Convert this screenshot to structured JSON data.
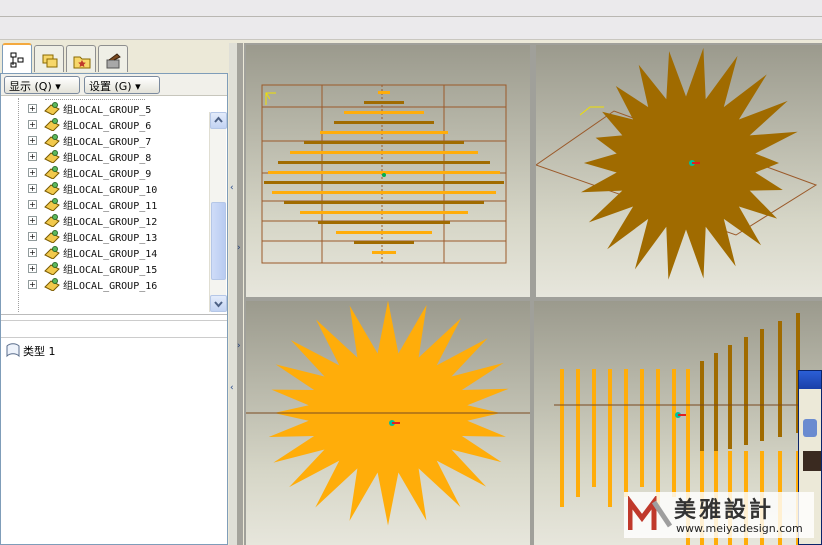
{
  "tabs": [
    {
      "icon": "model-tree-icon",
      "active": true
    },
    {
      "icon": "layers-icon",
      "active": false
    },
    {
      "icon": "favorites-folder-icon",
      "active": false
    },
    {
      "icon": "tools-icon",
      "active": false
    }
  ],
  "toolbar": {
    "show_label": "显示 (Q) ▾",
    "settings_label": "设置 (G) ▾"
  },
  "tree": {
    "items": [
      {
        "label": "组LOCAL_GROUP_5"
      },
      {
        "label": "组LOCAL_GROUP_6"
      },
      {
        "label": "组LOCAL_GROUP_7"
      },
      {
        "label": "组LOCAL_GROUP_8"
      },
      {
        "label": "组LOCAL_GROUP_9"
      },
      {
        "label": "组LOCAL_GROUP_10"
      },
      {
        "label": "组LOCAL_GROUP_11"
      },
      {
        "label": "组LOCAL_GROUP_12"
      },
      {
        "label": "组LOCAL_GROUP_13"
      },
      {
        "label": "组LOCAL_GROUP_14"
      },
      {
        "label": "组LOCAL_GROUP_15"
      },
      {
        "label": "组LOCAL_GROUP_16"
      }
    ]
  },
  "layer_panel": {
    "item_label": "类型 1"
  },
  "watermark": {
    "brand": "美雅設計",
    "url": "www.meiyadesign.com"
  },
  "colors": {
    "accent": "#f4a93e",
    "model_orange": "#ffad0a",
    "model_dark": "#a06b00",
    "frame_brown": "#9b5a2a"
  }
}
